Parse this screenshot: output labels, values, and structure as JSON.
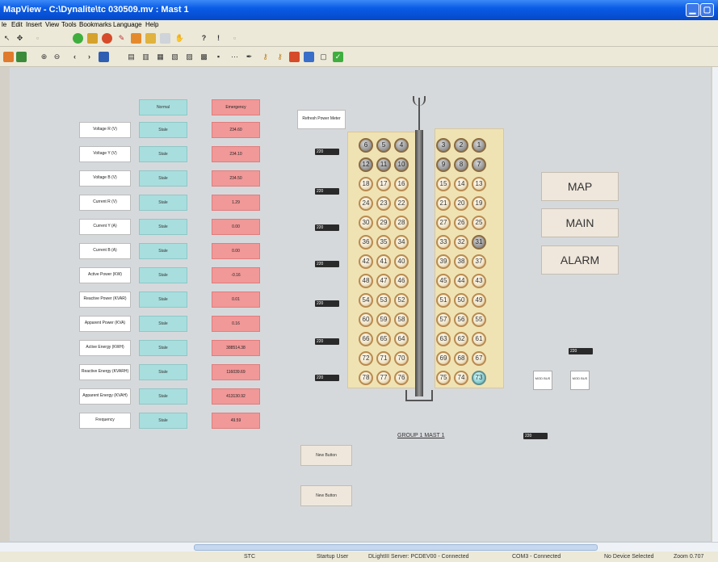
{
  "window": {
    "title": "MapView - C:\\Dynalite\\tc 030509.mv : Mast 1"
  },
  "menu": [
    "le",
    "Edit",
    "Insert",
    "View",
    "Tools",
    "Bookmarks",
    "Language",
    "Help"
  ],
  "table": {
    "header_normal": "Normal",
    "header_emergency": "Emergency",
    "rows": [
      {
        "label": "Voltage R (V)",
        "normal": "Stale",
        "emergency": "234.60"
      },
      {
        "label": "Voltage Y (V)",
        "normal": "Stale",
        "emergency": "234.10"
      },
      {
        "label": "Voltage B (V)",
        "normal": "Stale",
        "emergency": "234.50"
      },
      {
        "label": "Current R (V)",
        "normal": "Stale",
        "emergency": "1.29"
      },
      {
        "label": "Current Y (A)",
        "normal": "Stale",
        "emergency": "0.00"
      },
      {
        "label": "Current B (A)",
        "normal": "Stale",
        "emergency": "0.00"
      },
      {
        "label": "Active Power (KW)",
        "normal": "Stale",
        "emergency": "-0.16"
      },
      {
        "label": "Reactive Power (KVAR)",
        "normal": "Stale",
        "emergency": "0.01"
      },
      {
        "label": "Apparent Power (KVA)",
        "normal": "Stale",
        "emergency": "0.16"
      },
      {
        "label": "Active Energy (KWH)",
        "normal": "Stale",
        "emergency": "388514.38"
      },
      {
        "label": "Reactive Energy (KVARH)",
        "normal": "Stale",
        "emergency": "116039.69"
      },
      {
        "label": "Apparent Energy (KVAH)",
        "normal": "Stale",
        "emergency": "413130.92"
      },
      {
        "label": "Frequency",
        "normal": "Stale",
        "emergency": "49.59"
      }
    ]
  },
  "refresh_button": "Refresh Power Meter",
  "relay_label": "220",
  "right_buttons": {
    "map": "MAP",
    "main": "MAIN",
    "alarm": "ALARM"
  },
  "group_label": "GROUP 1 MAST 1",
  "new_button_1": "New Button",
  "new_button_2": "New Button",
  "modbus_1": "MOD BUS",
  "modbus_2": "MOD BUS",
  "lamps_left": [
    [
      "6",
      "5",
      "4"
    ],
    [
      "12",
      "11",
      "10"
    ],
    [
      "18",
      "17",
      "16"
    ],
    [
      "24",
      "23",
      "22"
    ],
    [
      "30",
      "29",
      "28"
    ],
    [
      "36",
      "35",
      "34"
    ],
    [
      "42",
      "41",
      "40"
    ],
    [
      "48",
      "47",
      "46"
    ],
    [
      "54",
      "53",
      "52"
    ],
    [
      "60",
      "59",
      "58"
    ],
    [
      "66",
      "65",
      "64"
    ],
    [
      "72",
      "71",
      "70"
    ],
    [
      "78",
      "77",
      "76"
    ]
  ],
  "lamps_right": [
    [
      "3",
      "2",
      "1"
    ],
    [
      "9",
      "8",
      "7"
    ],
    [
      "15",
      "14",
      "13"
    ],
    [
      "21",
      "20",
      "19"
    ],
    [
      "27",
      "26",
      "25"
    ],
    [
      "33",
      "32",
      "31"
    ],
    [
      "39",
      "38",
      "37"
    ],
    [
      "45",
      "44",
      "43"
    ],
    [
      "51",
      "50",
      "49"
    ],
    [
      "57",
      "56",
      "55"
    ],
    [
      "63",
      "62",
      "61"
    ],
    [
      "69",
      "68",
      "67"
    ],
    [
      "75",
      "74",
      "73"
    ]
  ],
  "status": {
    "stc": "STC",
    "user": "Startup User",
    "server": "DLightIII Server: PCDEV00 - Connected",
    "com": "COM3 - Connected",
    "device": "No Device Selected",
    "zoom": "Zoom 0.707"
  },
  "colors": {
    "normal_cell": "#a9dede",
    "emergency_cell": "#f19898",
    "lamp_panel": "#f0e3b3",
    "title_bar": "#0a5ce6"
  }
}
